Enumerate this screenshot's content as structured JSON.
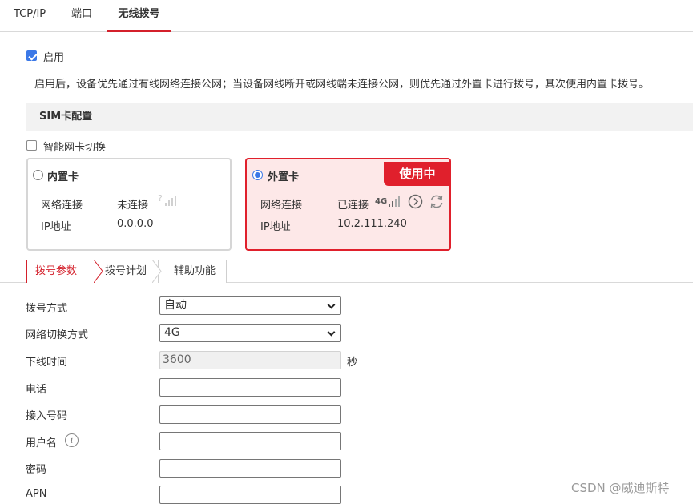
{
  "top_tabs": [
    "TCP/IP",
    "端口",
    "无线拨号"
  ],
  "enable": {
    "label": "启用",
    "checked": true
  },
  "description": "启用后，设备优先通过有线网络连接公网；当设备网线断开或网线端未连接公网，则优先通过外置卡进行拨号，其次使用内置卡拨号。",
  "sim_section_title": "SIM卡配置",
  "smart_switch": {
    "label": "智能网卡切换",
    "checked": false
  },
  "inner_card": {
    "title": "内置卡",
    "selected": false,
    "network_label": "网络连接",
    "network_value": "未连接",
    "ip_label": "IP地址",
    "ip_value": "0.0.0.0"
  },
  "outer_card": {
    "title": "外置卡",
    "selected": true,
    "badge": "使用中",
    "network_label": "网络连接",
    "network_value": "已连接",
    "signal_text": "4G",
    "ip_label": "IP地址",
    "ip_value": "10.2.111.240"
  },
  "sub_tabs": [
    "拨号参数",
    "拨号计划",
    "辅助功能"
  ],
  "form": {
    "dial_mode": {
      "label": "拨号方式",
      "value": "自动"
    },
    "network_switch": {
      "label": "网络切换方式",
      "value": "4G"
    },
    "offline_time": {
      "label": "下线时间",
      "value": "3600",
      "unit": "秒"
    },
    "phone": {
      "label": "电话",
      "value": ""
    },
    "access_number": {
      "label": "接入号码",
      "value": ""
    },
    "username": {
      "label": "用户名",
      "value": ""
    },
    "password": {
      "label": "密码",
      "value": ""
    },
    "apn": {
      "label": "APN",
      "value": ""
    }
  },
  "watermark": "CSDN @威迪斯特",
  "colors": {
    "accent": "#d4202b",
    "checkbox": "#3b78e7",
    "active_card_bg": "#fde8e8"
  }
}
